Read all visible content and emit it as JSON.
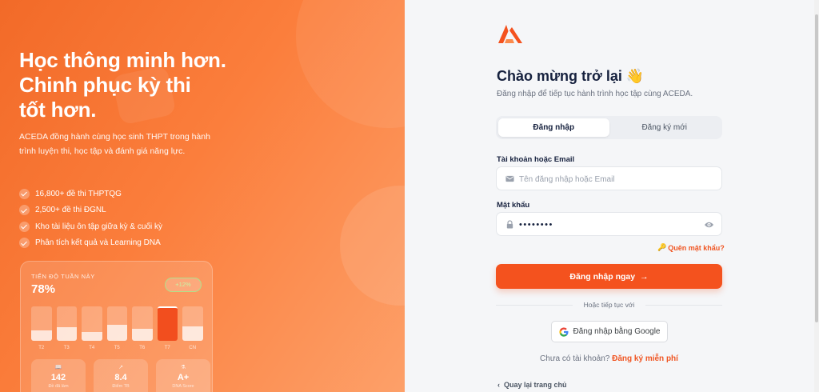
{
  "hero": {
    "headline": [
      "Học thông minh hơn.",
      "Chinh phục kỳ thi",
      "tốt hơn."
    ],
    "intro": "ACEDA đồng hành cùng học sinh THPT trong hành trình luyện thi, học tập và đánh giá năng lực.",
    "features": [
      "16,800+ đề thi THPTQG",
      "2,500+ đề thi ĐGNL",
      "Kho tài liệu ôn tập giữa kỳ & cuối kỳ",
      "Phân tích kết quả và Learning DNA"
    ]
  },
  "progress_card": {
    "label": "TIẾN ĐỘ TUẦN NÀY",
    "percent": "78%",
    "badge": "+12%",
    "bars": [
      {
        "day": "T2",
        "level": 0.55,
        "active": false
      },
      {
        "day": "T3",
        "level": 0.72,
        "active": false
      },
      {
        "day": "T4",
        "level": 0.48,
        "active": false
      },
      {
        "day": "T5",
        "level": 0.85,
        "active": false
      },
      {
        "day": "T6",
        "level": 0.62,
        "active": false
      },
      {
        "day": "T7",
        "level": 1.0,
        "active": true
      },
      {
        "day": "CN",
        "level": 0.78,
        "active": false
      }
    ],
    "stats": [
      {
        "icon": "book-icon",
        "value": "142",
        "label": "Đề đã làm"
      },
      {
        "icon": "trend-icon",
        "value": "8.4",
        "label": "Điểm TB"
      },
      {
        "icon": "dna-icon",
        "value": "A+",
        "label": "DNA Score"
      }
    ]
  },
  "login": {
    "title": "Chào mừng trở lại 👋",
    "subtitle": "Đăng nhập để tiếp tục hành trình học tập cùng ACEDA.",
    "tabs": [
      {
        "label": "Đăng nhập",
        "active": true
      },
      {
        "label": "Đăng ký mới",
        "active": false
      }
    ],
    "username": {
      "label": "Tài khoản hoặc Email",
      "placeholder": "Tên đăng nhập hoặc Email",
      "value": ""
    },
    "password": {
      "label": "Mật khẩu",
      "value": "••••••••"
    },
    "forgot": "Quên mật khẩu?",
    "submit": "Đăng nhập ngay",
    "divider": "Hoặc tiếp tục với",
    "google": "Đăng nhập bằng Google",
    "signup_prompt": "Chưa có tài khoản?",
    "signup_link": "Đăng ký miễn phí",
    "back": "Quay lại trang chủ"
  },
  "colors": {
    "accent": "#f4521e",
    "navy": "#16213e",
    "hero_start": "#f26a28",
    "hero_end": "#fda069"
  }
}
